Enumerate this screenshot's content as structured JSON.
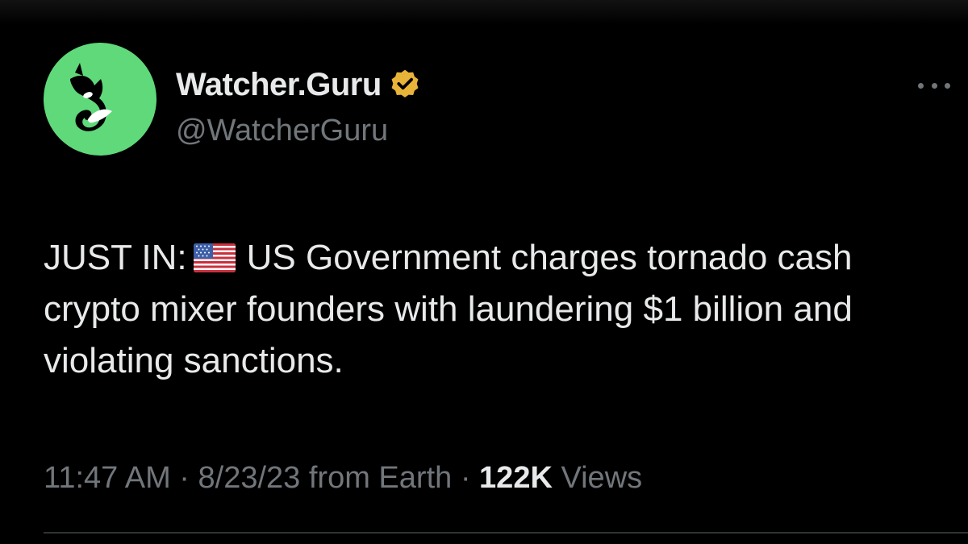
{
  "tweet": {
    "display_name": "Watcher.Guru",
    "handle": "@WatcherGuru",
    "text_prefix": "JUST IN:",
    "flag_icon": "us-flag-icon",
    "text_body": "US Government charges tornado cash crypto mixer founders with laundering $1 billion and violating sanctions.",
    "time": "11:47 AM",
    "separator": "·",
    "date": "8/23/23",
    "source": "from Earth",
    "views_count": "122K",
    "views_label": "Views"
  },
  "colors": {
    "background": "#000000",
    "avatar": "#5fd97a",
    "verified_badge": "#e8b339",
    "primary_text": "#e7e9ea",
    "secondary_text": "#71767b"
  }
}
